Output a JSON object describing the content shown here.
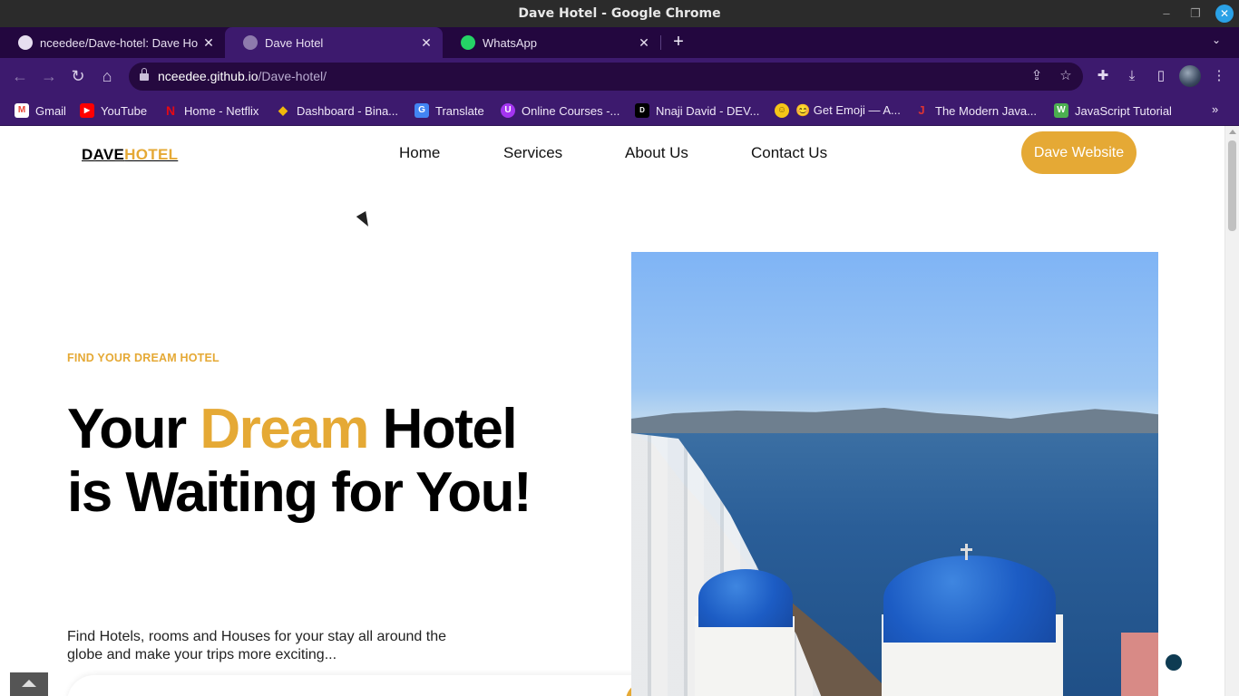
{
  "window": {
    "title": "Dave Hotel - Google Chrome",
    "minimize_glyph": "–",
    "maximize_glyph": "❐",
    "close_glyph": "✕"
  },
  "tabs": [
    {
      "label": "nceedee/Dave-hotel: Dave Ho",
      "icon": "github-icon",
      "close": "✕"
    },
    {
      "label": "Dave Hotel",
      "icon": "globe-icon",
      "close": "✕"
    },
    {
      "label": "WhatsApp",
      "icon": "whatsapp-icon",
      "close": "✕"
    }
  ],
  "tabstrip": {
    "new_tab_glyph": "+",
    "tab_search_glyph": "⌄"
  },
  "toolbar": {
    "back_glyph": "←",
    "forward_glyph": "→",
    "reload_glyph": "↻",
    "home_glyph": "⌂",
    "url_host": "nceedee.github.io",
    "url_path": "/Dave-hotel/",
    "share_glyph": "⇪",
    "star_glyph": "☆",
    "extensions_glyph": "✚",
    "download_glyph": "⤓",
    "sidepanel_glyph": "▯",
    "menu_glyph": "⋮"
  },
  "bookmarks": [
    {
      "label": "Gmail",
      "icon": "gmail-icon",
      "glyph": "M",
      "color": "#ea4335"
    },
    {
      "label": "YouTube",
      "icon": "youtube-icon",
      "glyph": "▶",
      "color": "#ff0000"
    },
    {
      "label": "Home - Netflix",
      "icon": "netflix-icon",
      "glyph": "N",
      "color": "#e50914"
    },
    {
      "label": "Dashboard - Bina...",
      "icon": "binance-icon",
      "glyph": "◆",
      "color": "#f0b90b"
    },
    {
      "label": "Translate",
      "icon": "translate-icon",
      "glyph": "G",
      "color": "#4285f4"
    },
    {
      "label": "Online Courses -...",
      "icon": "udemy-icon",
      "glyph": "U",
      "color": "#a435f0"
    },
    {
      "label": "Nnaji David - DEV...",
      "icon": "dev-icon",
      "glyph": "D",
      "color": "#000000"
    },
    {
      "label": "😊 Get Emoji — A...",
      "icon": "emoji-icon",
      "glyph": "☺",
      "color": "#f5c518"
    },
    {
      "label": "The Modern Java...",
      "icon": "javascript-info-icon",
      "glyph": "J",
      "color": "#dd3333"
    },
    {
      "label": "JavaScript Tutorial",
      "icon": "w3schools-icon",
      "glyph": "W",
      "color": "#4caf50"
    }
  ],
  "bookmarks_more_glyph": "»",
  "site": {
    "logo_part1": "DAVE",
    "logo_part2": "HOTEL",
    "nav": [
      "Home",
      "Services",
      "About Us",
      "Contact Us"
    ],
    "cta": "Dave Website",
    "eyebrow": "FIND YOUR DREAM HOTEL",
    "headline_part1": "Your ",
    "headline_accent": "Dream",
    "headline_part2": " Hotel is Waiting for You!",
    "lead": "Find Hotels, rooms and Houses for your stay all around the globe and make your trips more exciting..."
  },
  "colors": {
    "accent": "#e5a935",
    "browser_frame": "#3d1a6e",
    "tab_strip": "#23073f"
  }
}
